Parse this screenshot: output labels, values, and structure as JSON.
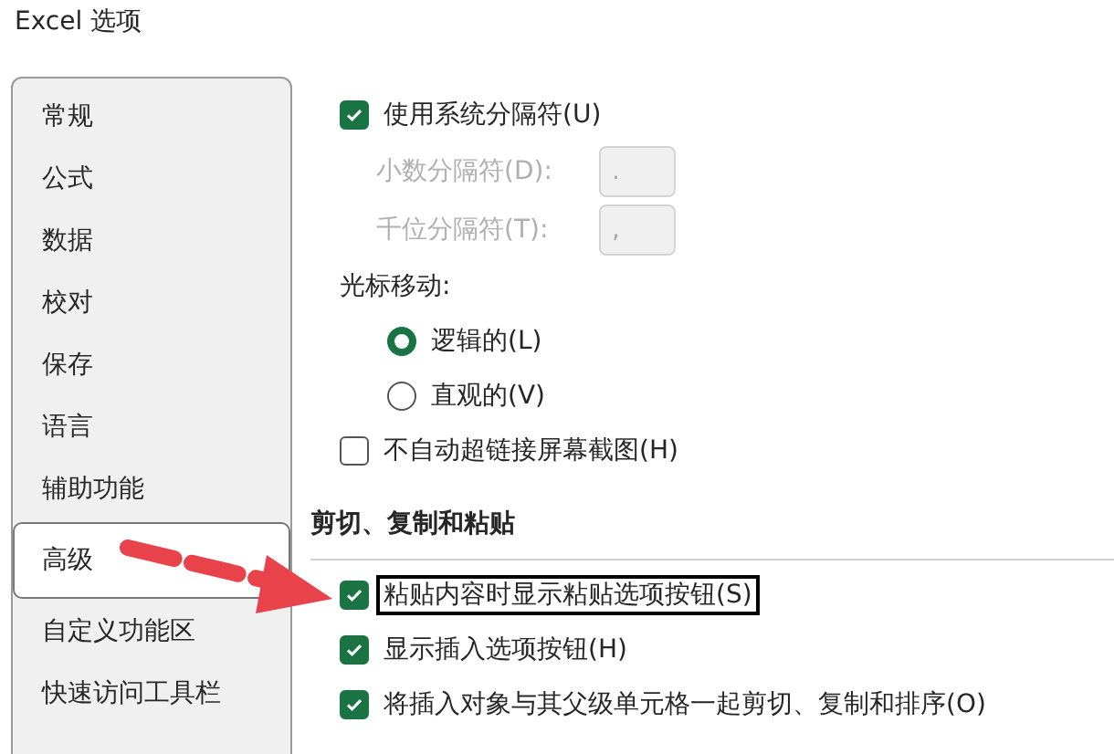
{
  "window": {
    "title": "Excel 选项"
  },
  "sidebar": {
    "items": [
      {
        "label": "常规",
        "selected": false
      },
      {
        "label": "公式",
        "selected": false
      },
      {
        "label": "数据",
        "selected": false
      },
      {
        "label": "校对",
        "selected": false
      },
      {
        "label": "保存",
        "selected": false
      },
      {
        "label": "语言",
        "selected": false
      },
      {
        "label": "辅助功能",
        "selected": false
      },
      {
        "label": "高级",
        "selected": true
      },
      {
        "label": "自定义功能区",
        "selected": false
      },
      {
        "label": "快速访问工具栏",
        "selected": false
      }
    ]
  },
  "separators": {
    "use_system": {
      "label": "使用系统分隔符(U)",
      "checked": true
    },
    "fields": [
      {
        "label": "小数分隔符(D):",
        "value": ".",
        "disabled": true
      },
      {
        "label": "千位分隔符(T):",
        "value": ",",
        "disabled": true
      }
    ]
  },
  "cursor_movement": {
    "label": "光标移动:",
    "options": [
      {
        "label": "逻辑的(L)",
        "selected": true
      },
      {
        "label": "直观的(V)",
        "selected": false
      }
    ]
  },
  "no_hyperlink": {
    "label": "不自动超链接屏幕截图(H)",
    "checked": false
  },
  "cut_copy_paste": {
    "heading": "剪切、复制和粘贴",
    "options": [
      {
        "label": "粘贴内容时显示粘贴选项按钮(S)",
        "checked": true,
        "focused": true
      },
      {
        "label": "显示插入选项按钮(H)",
        "checked": true,
        "focused": false
      },
      {
        "label": "将插入对象与其父级单元格一起剪切、复制和排序(O)",
        "checked": true,
        "focused": false
      }
    ]
  }
}
